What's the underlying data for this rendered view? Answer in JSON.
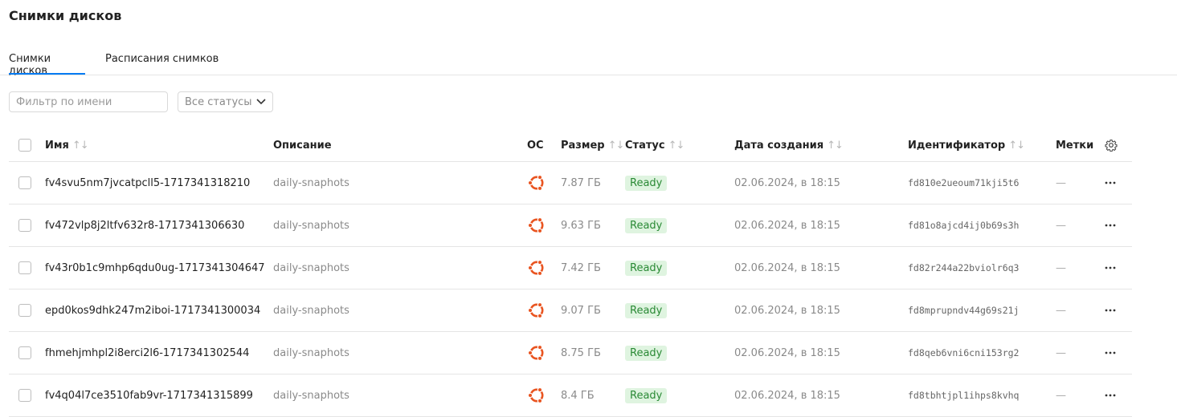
{
  "page_title": "Снимки дисков",
  "tabs": [
    {
      "label": "Снимки дисков",
      "active": true
    },
    {
      "label": "Расписания снимков",
      "active": false
    }
  ],
  "filters": {
    "name_placeholder": "Фильтр по имени",
    "status_value": "Все статусы"
  },
  "table": {
    "headers": {
      "name": "Имя",
      "description": "Описание",
      "os": "ОС",
      "size": "Размер",
      "status": "Статус",
      "created": "Дата создания",
      "id": "Идентификатор",
      "labels": "Метки"
    },
    "sort_glyph": "↑↓",
    "rows": [
      {
        "name": "fv4svu5nm7jvcatpcll5-1717341318210",
        "description": "daily-snaphots",
        "os": "ubuntu-icon",
        "size": "7.87 ГБ",
        "status": "Ready",
        "created": "02.06.2024, в 18:15",
        "id": "fd810e2ueoum71kji5t6",
        "labels": "—"
      },
      {
        "name": "fv472vlp8j2ltfv632r8-1717341306630",
        "description": "daily-snaphots",
        "os": "ubuntu-icon",
        "size": "9.63 ГБ",
        "status": "Ready",
        "created": "02.06.2024, в 18:15",
        "id": "fd81o8ajcd4ij0b69s3h",
        "labels": "—"
      },
      {
        "name": "fv43r0b1c9mhp6qdu0ug-1717341304647",
        "description": "daily-snaphots",
        "os": "ubuntu-icon",
        "size": "7.42 ГБ",
        "status": "Ready",
        "created": "02.06.2024, в 18:15",
        "id": "fd82r244a22bviolr6q3",
        "labels": "—"
      },
      {
        "name": "epd0kos9dhk247m2iboi-1717341300034",
        "description": "daily-snaphots",
        "os": "ubuntu-icon",
        "size": "9.07 ГБ",
        "status": "Ready",
        "created": "02.06.2024, в 18:15",
        "id": "fd8mprupndv44g69s21j",
        "labels": "—"
      },
      {
        "name": "fhmehjmhpl2i8erci2l6-1717341302544",
        "description": "daily-snaphots",
        "os": "ubuntu-icon",
        "size": "8.75 ГБ",
        "status": "Ready",
        "created": "02.06.2024, в 18:15",
        "id": "fd8qeb6vni6cni153rg2",
        "labels": "—"
      },
      {
        "name": "fv4q04l7ce3510fab9vr-1717341315899",
        "description": "daily-snaphots",
        "os": "ubuntu-icon",
        "size": "8.4 ГБ",
        "status": "Ready",
        "created": "02.06.2024, в 18:15",
        "id": "fd8tbhtjpl1ihps8kvhq",
        "labels": "—"
      }
    ]
  },
  "colors": {
    "accent": "#027bf3",
    "ubuntu": "#e95420",
    "ready_bg": "#dff4e0",
    "ready_text": "#2a8a35"
  }
}
